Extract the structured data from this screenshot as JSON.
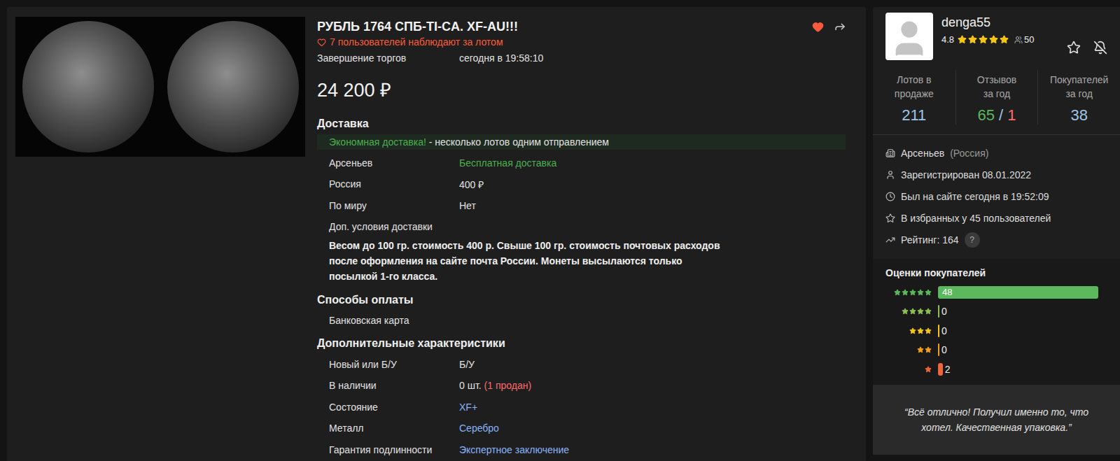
{
  "lot": {
    "title": "РУБЛЬ 1764 СПБ-TI-CA. XF-AU!!!",
    "favorite": true,
    "watchers": "7 пользователей наблюдают за лотом",
    "end_label": "Завершение торгов",
    "end_value": "сегодня в 19:58:10",
    "price": "24 200 ₽"
  },
  "delivery": {
    "heading": "Доставка",
    "promo_highlight": "Экономная доставка!",
    "promo_rest": " - несколько лотов одним отправлением",
    "rows": [
      {
        "label": "Арсеньев",
        "value": "Бесплатная доставка",
        "kind": "free"
      },
      {
        "label": "Россия",
        "value": "400 ₽",
        "kind": "plain"
      },
      {
        "label": "По миру",
        "value": "Нет",
        "kind": "plain"
      }
    ],
    "extra_label": "Доп. условия доставки",
    "extra_text": "Весом до 100 гр. стоимость 400 р. Свыше 100 гр. стоимость почтовых расходов после оформления на сайте почта России. Монеты высылаются только посылкой 1-го класса."
  },
  "payment": {
    "heading": "Способы оплаты",
    "methods": [
      "Банковская карта"
    ]
  },
  "specs": {
    "heading": "Дополнительные характеристики",
    "rows": [
      {
        "label": "Новый или Б/У",
        "value": "Б/У",
        "note": "",
        "kind": "plain"
      },
      {
        "label": "В наличии",
        "value": "0 шт.",
        "note": "(1 продан)",
        "kind": "plain"
      },
      {
        "label": "Состояние",
        "value": "XF+",
        "note": "",
        "kind": "link"
      },
      {
        "label": "Металл",
        "value": "Серебро",
        "note": "",
        "kind": "link"
      },
      {
        "label": "Гарантия подлинности",
        "value": "Экспертное заключение",
        "note": "",
        "kind": "link"
      }
    ]
  },
  "seller": {
    "name": "denga55",
    "rating": "4.8",
    "stars": 5,
    "followers": "50",
    "followed": false,
    "notifications": false,
    "stats": [
      {
        "lines": [
          "Лотов в",
          "продаже"
        ],
        "parts": [
          {
            "text": "211",
            "kind": "neutral"
          }
        ]
      },
      {
        "lines": [
          "Отзывов",
          "за год"
        ],
        "parts": [
          {
            "text": "65",
            "kind": "positive"
          },
          {
            "text": " / ",
            "kind": "neutral"
          },
          {
            "text": "1",
            "kind": "negative"
          }
        ]
      },
      {
        "lines": [
          "Покупателей",
          "за год"
        ],
        "parts": [
          {
            "text": "38",
            "kind": "neutral"
          }
        ]
      }
    ],
    "info": [
      {
        "kind": "city",
        "text": "Арсеньев",
        "note": "(Россия)",
        "badge": ""
      },
      {
        "kind": "registered",
        "text": "Зарегистрирован 08.01.2022",
        "note": "",
        "badge": ""
      },
      {
        "kind": "seen",
        "text": "Был на сайте сегодня в 19:52:09",
        "note": "",
        "badge": ""
      },
      {
        "kind": "favorites",
        "text": "В избранных у 45 пользователей",
        "note": "",
        "badge": ""
      },
      {
        "kind": "rating",
        "text": "Рейтинг: 164",
        "note": "",
        "badge": "?"
      }
    ]
  },
  "ratings": {
    "heading": "Оценки покупателей",
    "rows": [
      {
        "stars": 5,
        "count": "48",
        "level": 1,
        "color": "#5cb85c"
      },
      {
        "stars": 4,
        "count": "0",
        "level": 0,
        "color": "#8cc152"
      },
      {
        "stars": 3,
        "count": "0",
        "level": 0,
        "color": "#f5c518"
      },
      {
        "stars": 2,
        "count": "0",
        "level": 0,
        "color": "#f59e1b"
      },
      {
        "stars": 1,
        "count": "2",
        "level": 0.03,
        "color": "#f0643c"
      }
    ]
  },
  "review": {
    "quote": "“Всё отлично! Получил именно то, что хотел. Качественная упаковка.”"
  }
}
